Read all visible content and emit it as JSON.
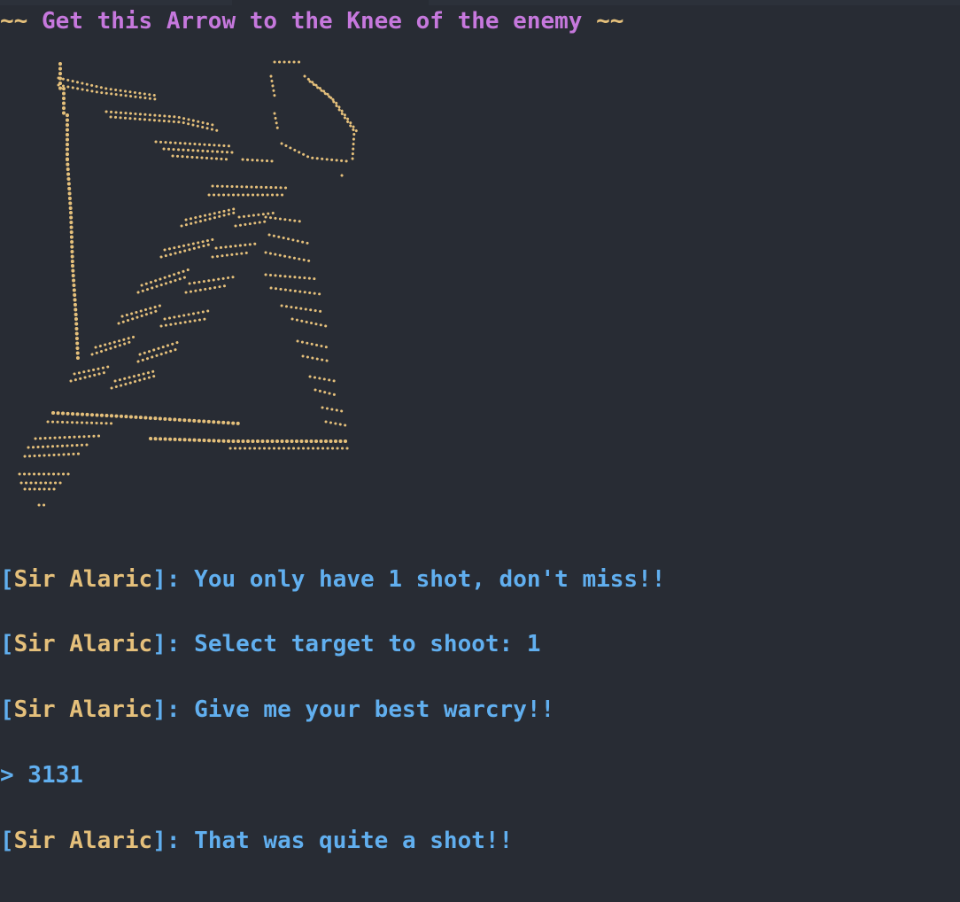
{
  "banner": {
    "prefix": "~~",
    "title": " Get this Arrow to the Knee of the enemy ",
    "suffix": "~~"
  },
  "art": {
    "icon": "bow-and-arrow-dot-art",
    "color": "#e5c07b"
  },
  "dialog": [
    {
      "speaker": "Sir Alaric",
      "text": ": You only have 1 shot, don't miss!!"
    },
    {
      "speaker": "Sir Alaric",
      "text": ": Select target to shoot: 1"
    },
    {
      "speaker": "Sir Alaric",
      "text": ": Give me your best warcry!!"
    }
  ],
  "input": {
    "prompt": ">",
    "value": " 3131"
  },
  "response": {
    "speaker": "Sir Alaric",
    "text": ": That was quite a shot!!"
  },
  "colors": {
    "background": "#282c34",
    "accent_yellow": "#e5c07b",
    "accent_purple": "#c678dd",
    "accent_blue": "#61afef"
  }
}
